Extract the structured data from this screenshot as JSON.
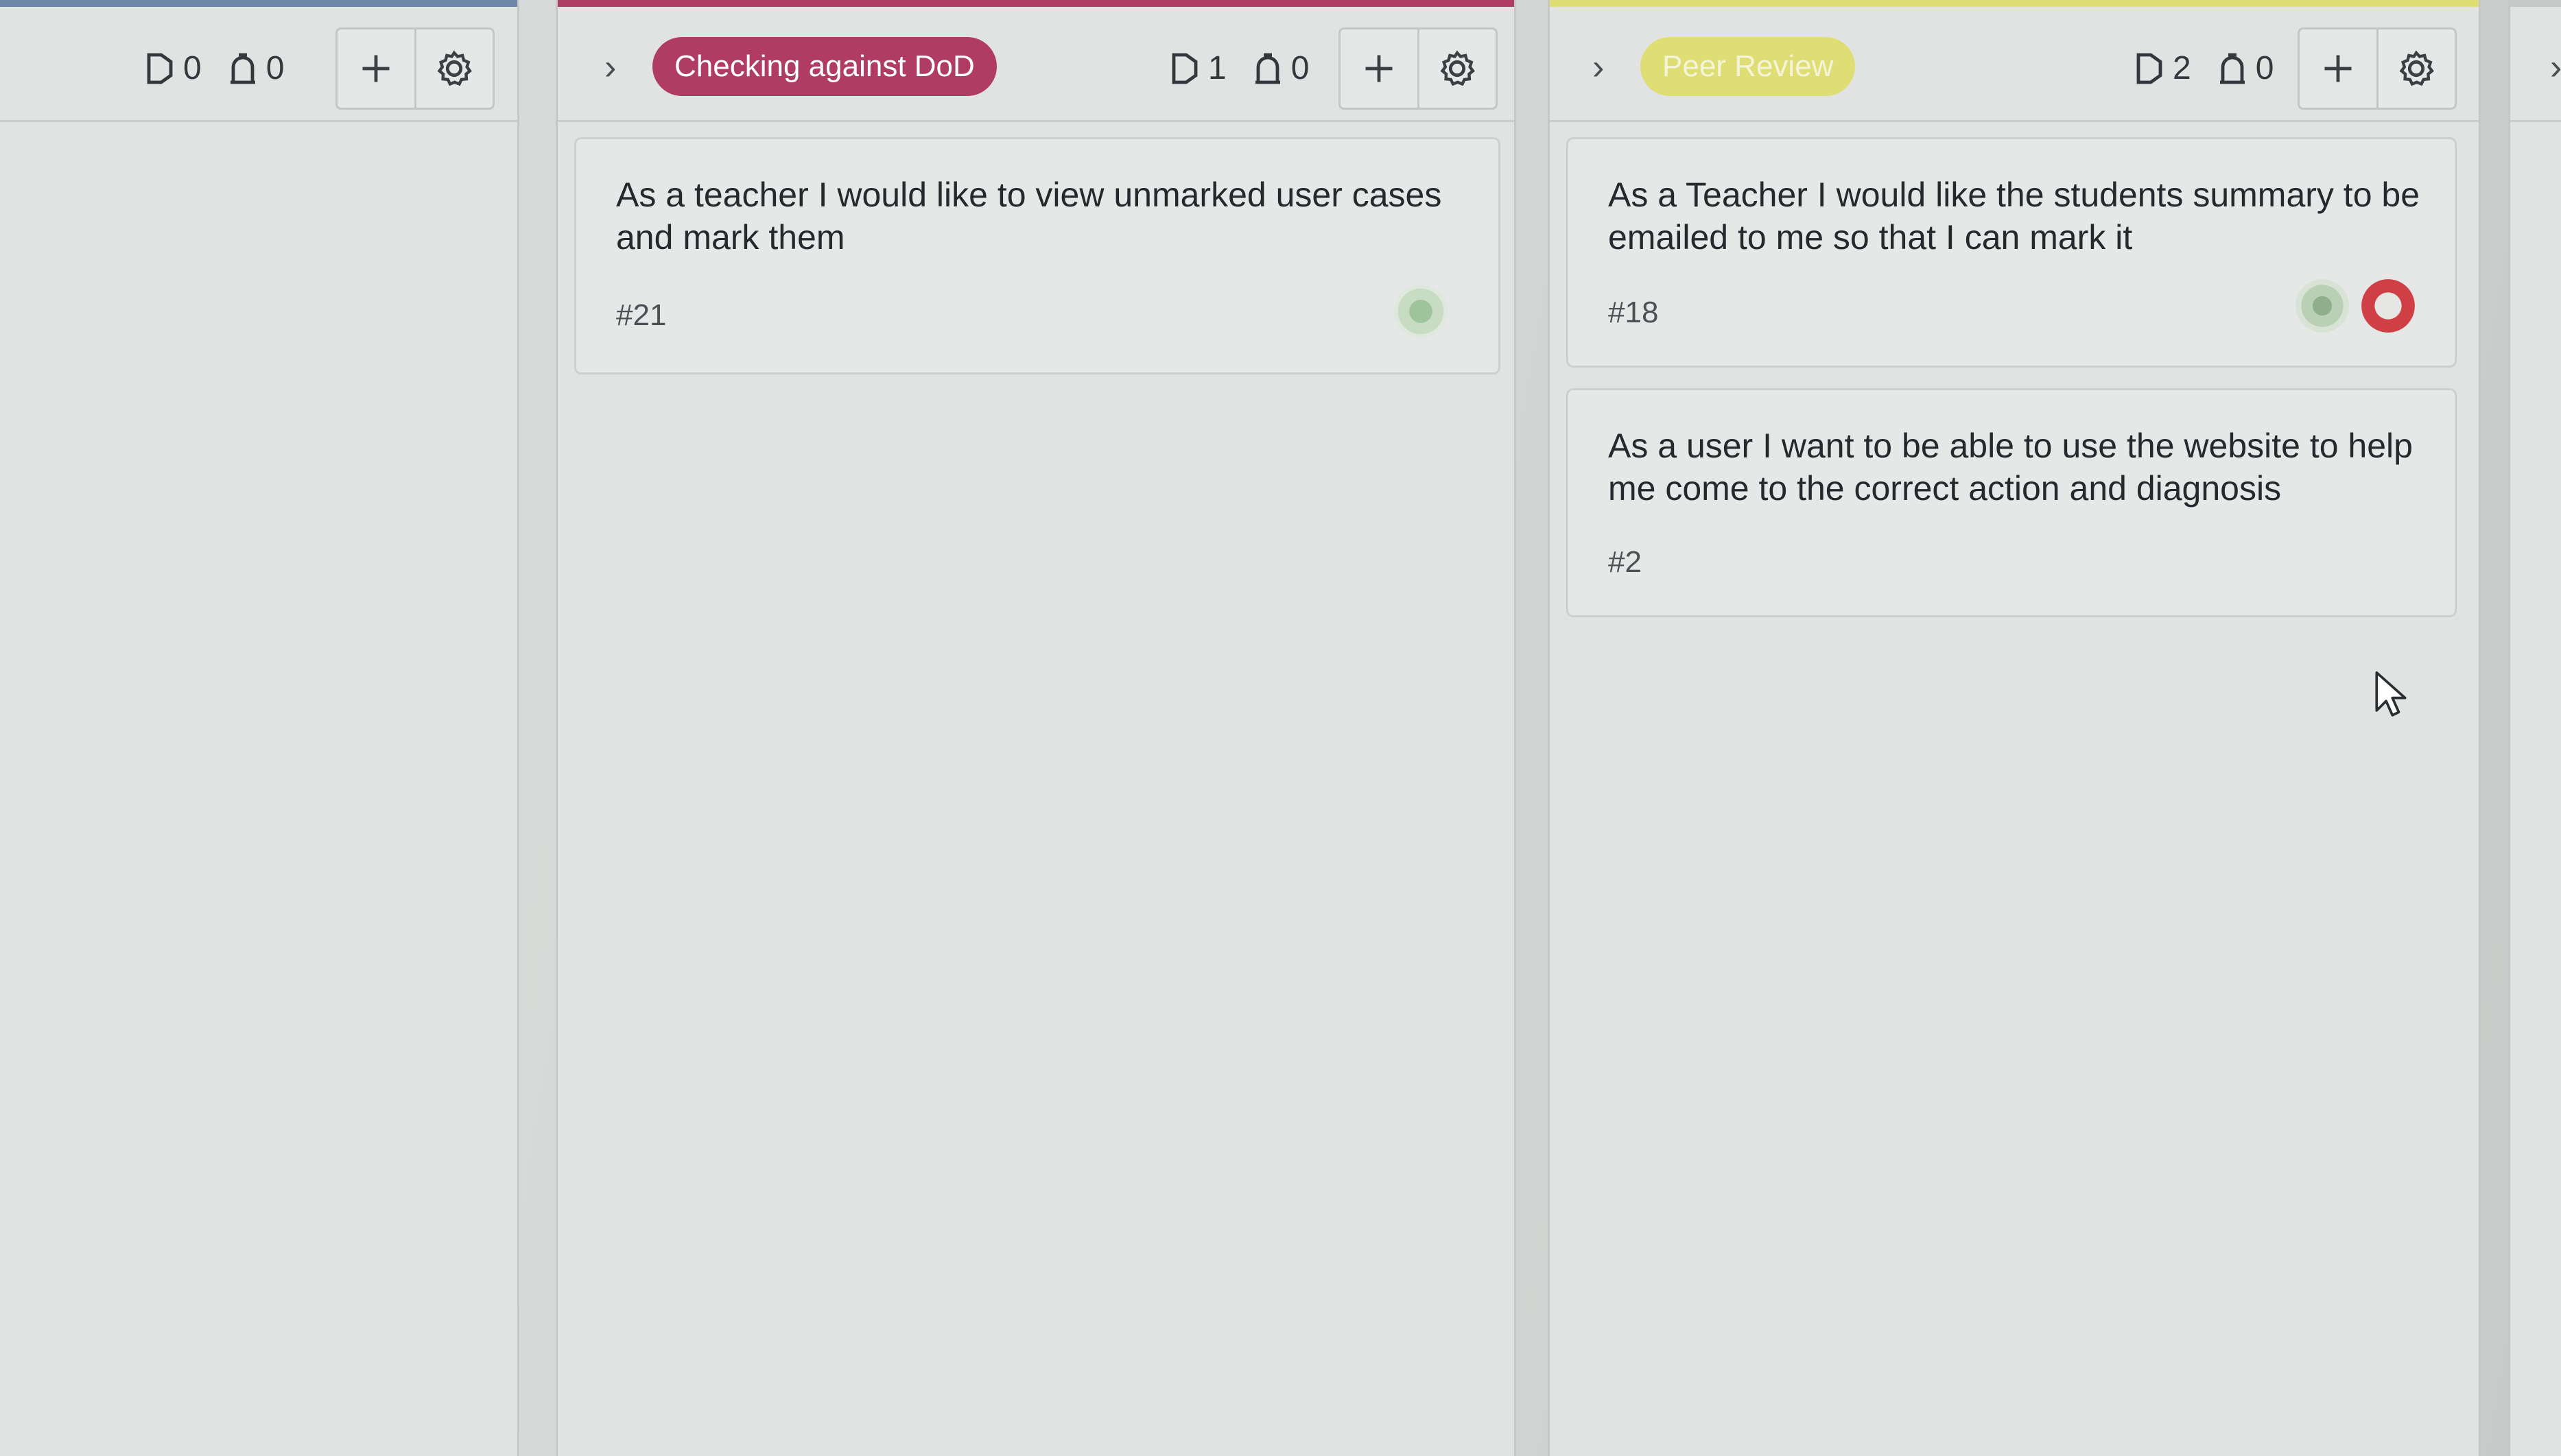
{
  "columns": [
    {
      "counts": {
        "issues": "0",
        "pull_requests": "0"
      }
    },
    {
      "label": "Checking against DoD",
      "label_color": "#b03b63",
      "counts": {
        "issues": "1",
        "pull_requests": "0"
      },
      "cards": [
        {
          "title": "As a teacher I would like to view unmarked user cases and mark them",
          "number": "#21"
        }
      ]
    },
    {
      "label": "Peer Review",
      "label_color": "#dede74",
      "counts": {
        "issues": "2",
        "pull_requests": "0"
      },
      "cards": [
        {
          "title": "As a Teacher I would like the students summary to be emailed to me so that I can mark it",
          "number": "#18"
        },
        {
          "title": "As a user I want to be able to use the website to help me come to the correct action and diagnosis",
          "number": "#2"
        }
      ]
    }
  ],
  "icons": {
    "expand": "chevron-right-icon",
    "issue_count": "issue-opened-icon",
    "pr_count": "pull-request-icon",
    "add": "plus-icon",
    "settings": "gear-icon"
  }
}
